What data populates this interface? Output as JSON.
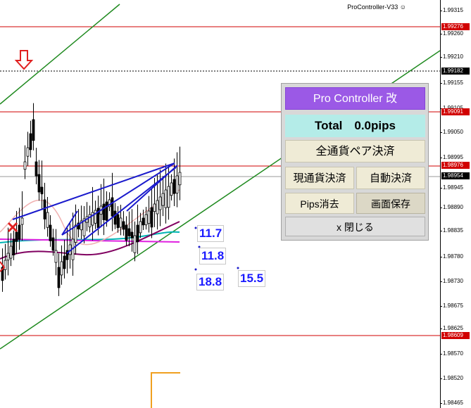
{
  "chart": {
    "title": "ProController-V33",
    "title_icon": "smiley-icon",
    "price_ticks": [
      "1.99315",
      "1.99260",
      "1.99210",
      "1.99155",
      "1.99105",
      "1.99050",
      "1.98995",
      "1.98945",
      "1.98890",
      "1.98835",
      "1.98780",
      "1.98730",
      "1.98675",
      "1.98625",
      "1.98570",
      "1.98520",
      "1.98465"
    ],
    "level_labels": [
      {
        "text": "1.99276",
        "color": "#d10000"
      },
      {
        "text": "1.99182",
        "color": "#000000"
      },
      {
        "text": "1.99091",
        "color": "#d10000"
      },
      {
        "text": "1.98976",
        "color": "#d10000"
      },
      {
        "text": "1.98954",
        "color": "#000000"
      },
      {
        "text": "1.98609",
        "color": "#d10000"
      }
    ],
    "pip_labels": [
      "11.7",
      "11.8",
      "18.8",
      "15.5"
    ]
  },
  "panel": {
    "title": "Pro Controller 改",
    "total": "Total　0.0pips",
    "close_all": "全通貨ペア決済",
    "close_current": "現通貨決済",
    "auto_close": "自動決済",
    "pips_clear": "Pips消去",
    "save_screen": "画面保存",
    "close_panel": "x 閉じる"
  }
}
